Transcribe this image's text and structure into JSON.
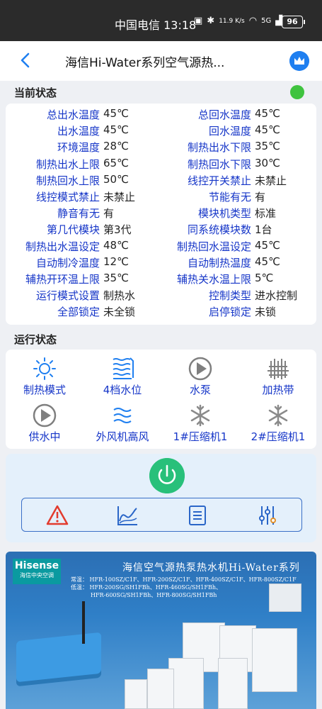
{
  "statusbar": {
    "carrier": "中国电信 13:18",
    "speed": "11.9 K/s",
    "network": "5G",
    "battery": "96"
  },
  "header": {
    "title": "海信Hi-Water系列空气源热..."
  },
  "current_status": {
    "title": "当前状态",
    "indicator_color": "#3fc33f",
    "rows": [
      {
        "l1": "总出水温度",
        "v1": "45℃",
        "l2": "总回水温度",
        "v2": "45℃"
      },
      {
        "l1": "出水温度",
        "v1": "45℃",
        "l2": "回水温度",
        "v2": "45℃"
      },
      {
        "l1": "环境温度",
        "v1": "28℃",
        "l2": "制热出水下限",
        "v2": "35℃"
      },
      {
        "l1": "制热出水上限",
        "v1": "65℃",
        "l2": "制热回水下限",
        "v2": "30℃"
      },
      {
        "l1": "制热回水上限",
        "v1": "50℃",
        "l2": "线控开关禁止",
        "v2": "未禁止"
      },
      {
        "l1": "线控模式禁止",
        "v1": "未禁止",
        "l2": "节能有无",
        "v2": "有"
      },
      {
        "l1": "静音有无",
        "v1": "有",
        "l2": "模块机类型",
        "v2": "标准"
      },
      {
        "l1": "第几代模块",
        "v1": "第3代",
        "l2": "同系统模块数",
        "v2": "1台"
      },
      {
        "l1": "制热出水温设定",
        "v1": "48℃",
        "l2": "制热回水温设定",
        "v2": "45℃"
      },
      {
        "l1": "自动制冷温度",
        "v1": "12℃",
        "l2": "自动制热温度",
        "v2": "45℃"
      },
      {
        "l1": "辅热开环温上限",
        "v1": "35℃",
        "l2": "辅热关水温上限",
        "v2": "5℃"
      },
      {
        "l1": "运行模式设置",
        "v1": "制热水",
        "l2": "控制类型",
        "v2": "进水控制"
      },
      {
        "l1": "全部锁定",
        "v1": "未全锁",
        "l2": "启停锁定",
        "v2": "未锁"
      }
    ]
  },
  "run_status": {
    "title": "运行状态",
    "items": [
      {
        "label": "制热模式",
        "icon": "sun-icon"
      },
      {
        "label": "4档水位",
        "icon": "water-level-icon"
      },
      {
        "label": "水泵",
        "icon": "pump-icon"
      },
      {
        "label": "加热带",
        "icon": "heater-icon"
      },
      {
        "label": "供水中",
        "icon": "supply-icon"
      },
      {
        "label": "外风机高风",
        "icon": "fan-wind-icon"
      },
      {
        "label": "1#压缩机1",
        "icon": "snowflake-icon"
      },
      {
        "label": "2#压缩机1",
        "icon": "snowflake-icon"
      }
    ]
  },
  "controls": {
    "power_icon": "power-icon",
    "tools": [
      "alarm-icon",
      "curve-icon",
      "list-icon",
      "settings-sliders-icon"
    ]
  },
  "banner": {
    "logo": "Hisense",
    "logo_sub": "海信中央空调",
    "title": "海信空气源热泵热水机Hi-Water系列",
    "models_line1": "常温： HFR-100SZ/C1F、HFR-200SZ/C1F、HFR-400SZ/C1F、HFR-800SZ/C1F",
    "models_line2": "低温： HFR-200SG/SH1FBh、HFR-460SG/SH1FBh、",
    "models_line3": "HFR-600SG/SH1FBh、HFR-800SG/SH1FBh"
  },
  "colors": {
    "label": "#1636c8",
    "accent": "#1f7ff0",
    "power": "#28c07a"
  }
}
